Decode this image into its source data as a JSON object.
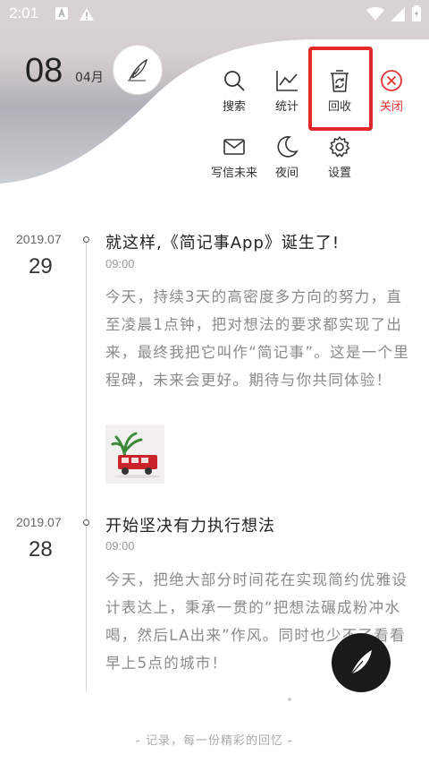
{
  "status_bar": {
    "time": "2:01"
  },
  "header": {
    "day": "08",
    "month": "04月"
  },
  "menu": {
    "search": "搜索",
    "stats": "统计",
    "recycle": "回收",
    "close": "关闭",
    "write_letter": "写信未来",
    "night": "夜间",
    "settings": "设置"
  },
  "entries": [
    {
      "year_month": "2019.07",
      "day": "29",
      "title": "就这样,《简记事App》诞生了!",
      "time": "09:00",
      "body": "今天，持续3天的高密度多方向的努力，直至凌晨1点钟，把对想法的要求都实现了出来，最终我把它叫作“简记事”。这是一个里程碑，未来会更好。期待与你共同体验！"
    },
    {
      "year_month": "2019.07",
      "day": "28",
      "title": "开始坚决有力执行想法",
      "time": "09:00",
      "body": "今天，把绝大部分时间花在实现简约优雅设计表达上，秉承一贯的“把想法碾成粉冲水喝，然后LA出来”作风。同时也少不了看看早上5点的城市！"
    }
  ],
  "footer": {
    "slogan": "- 记录，每一份精彩的回忆 -"
  },
  "colors": {
    "accent_red": "#e42828",
    "fab": "#1a1a1a"
  }
}
